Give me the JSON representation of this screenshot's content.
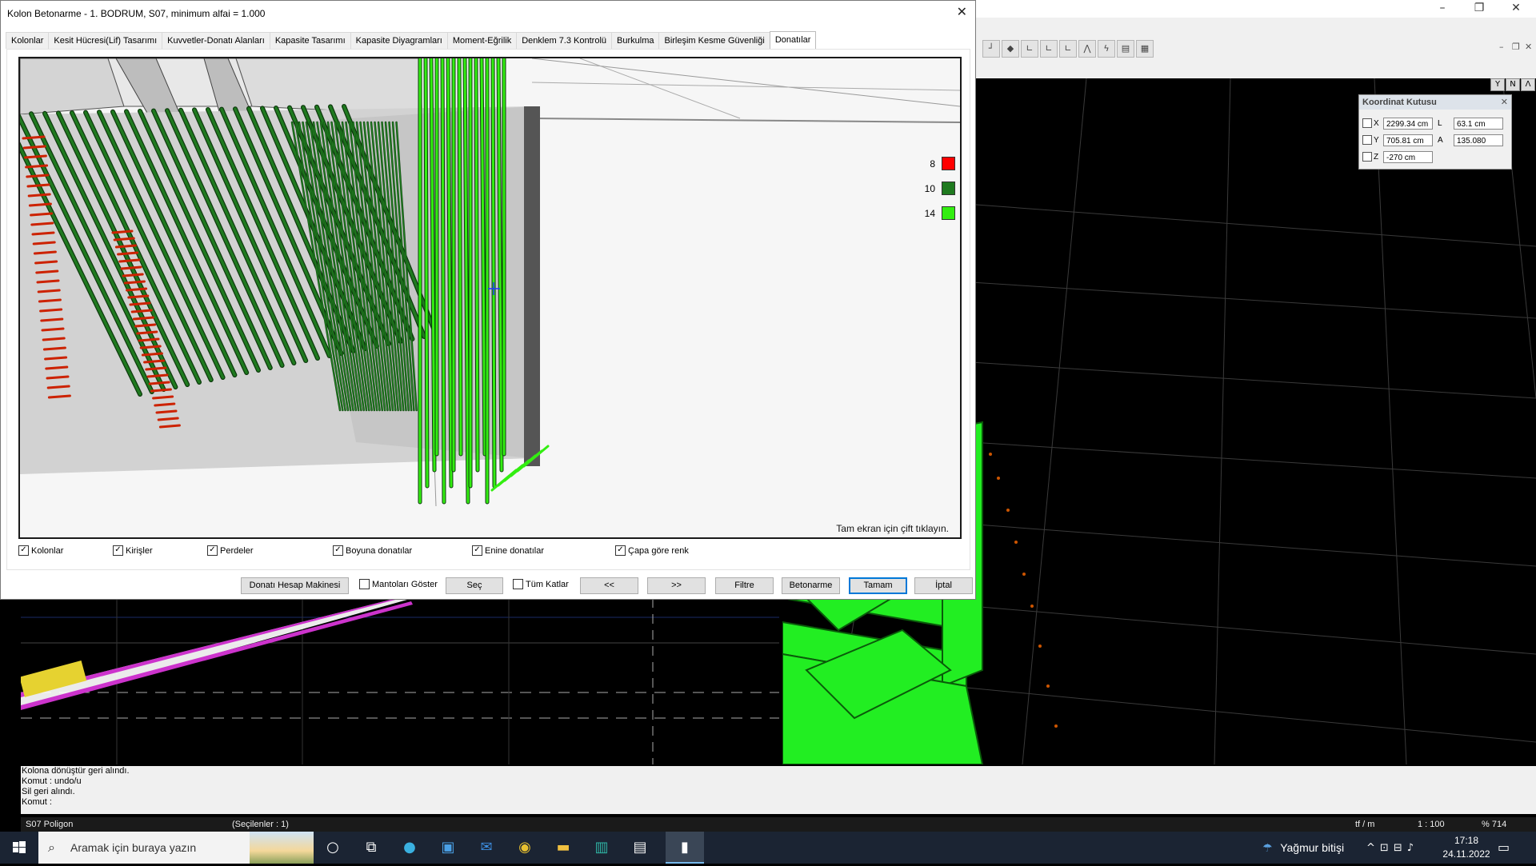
{
  "dialog": {
    "title": "Kolon Betonarme - 1. BODRUM, S07, minimum alfai = 1.000",
    "close_glyph": "✕",
    "tabs": [
      {
        "label": "Kolonlar",
        "active": false
      },
      {
        "label": "Kesit Hücresi(Lif) Tasarımı",
        "active": false
      },
      {
        "label": "Kuvvetler-Donatı Alanları",
        "active": false
      },
      {
        "label": "Kapasite Tasarımı",
        "active": false
      },
      {
        "label": "Kapasite Diyagramları",
        "active": false
      },
      {
        "label": "Moment-Eğrilik",
        "active": false
      },
      {
        "label": "Denklem 7.3 Kontrolü",
        "active": false
      },
      {
        "label": "Burkulma",
        "active": false
      },
      {
        "label": "Birleşim Kesme Güvenliği",
        "active": false
      },
      {
        "label": "Donatılar",
        "active": true
      }
    ],
    "legend": [
      {
        "label": "8",
        "color": "#ff0000"
      },
      {
        "label": "10",
        "color": "#1f7a1f"
      },
      {
        "label": "14",
        "color": "#33ee11"
      }
    ],
    "hint": "Tam ekran için çift tıklayın.",
    "checkboxes": [
      {
        "label": "Kolonlar",
        "checked": true
      },
      {
        "label": "Kirişler",
        "checked": true
      },
      {
        "label": "Perdeler",
        "checked": true
      },
      {
        "label": "Boyuna donatılar",
        "checked": true
      },
      {
        "label": "Enine donatılar",
        "checked": true
      },
      {
        "label": "Çapa göre renk",
        "checked": true
      }
    ],
    "check_glyph": "✓",
    "buttons": {
      "calc": "Donatı Hesap Makinesi",
      "mantolar": "Mantoları Göster",
      "sec": "Seç",
      "tum_katlar": "Tüm Katlar",
      "prev": "<<",
      "next": ">>",
      "filtre": "Filtre",
      "betonarme": "Betonarme",
      "tamam": "Tamam",
      "iptal": "İptal"
    }
  },
  "app": {
    "window_controls": {
      "minimize": "–",
      "restore": "❐",
      "close": "✕"
    },
    "sub_controls": {
      "minimize": "–",
      "restore": "❐",
      "close": "✕"
    },
    "viewport_controls": [
      "Y",
      "N",
      "Λ"
    ],
    "coord_box": {
      "title": "Koordinat Kutusu",
      "close": "✕",
      "rows": [
        {
          "axis": "X",
          "value": "2299.34 cm",
          "label2": "L",
          "value2": "63.1 cm"
        },
        {
          "axis": "Y",
          "value": "705.81 cm",
          "label2": "A",
          "value2": "135.080"
        },
        {
          "axis": "Z",
          "value": "-270 cm"
        }
      ]
    },
    "command_lines": [
      "Kolona dönüştür geri alındı.",
      "Komut : undo/u",
      "Sil geri alındı.",
      "Komut :"
    ],
    "status": {
      "object": "S07 Poligon",
      "selected": "(Seçilenler : 1)",
      "units": "tf / m",
      "scale": "1 : 100",
      "zoom": "% 714"
    }
  },
  "taskbar": {
    "search_placeholder": "Aramak için buraya yazın",
    "weather": "Yağmur bitişi",
    "time": "17:18",
    "date": "24.11.2022",
    "tray_icons": [
      "^",
      "⊡",
      "⊟",
      "♪"
    ]
  },
  "colors": {
    "rebar_dark_green": "#1f7a1f",
    "rebar_light_green": "#33ee11",
    "rebar_red": "#cc2200",
    "accent": "#0078d7"
  }
}
